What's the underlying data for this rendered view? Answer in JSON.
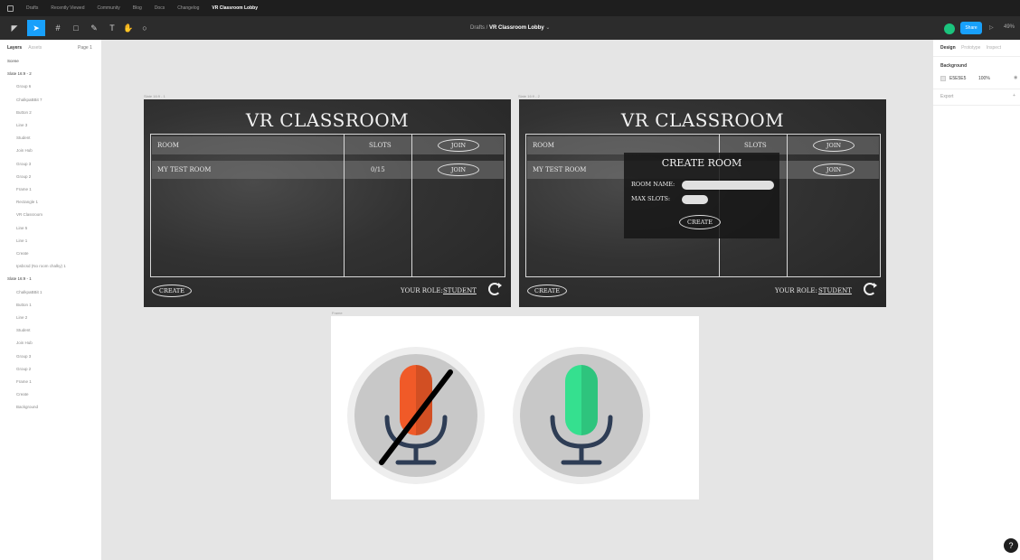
{
  "titlebar": {
    "tabs": [
      "Drafts",
      "Recently Viewed",
      "Community",
      "Blog",
      "Docs",
      "Changelog",
      "VR Classroom Lobby"
    ],
    "active_index": 6
  },
  "toolbar": {
    "breadcrumb_project": "Drafts /",
    "breadcrumb_file": "VR Classroom Lobby",
    "share_label": "Share",
    "zoom": "49%"
  },
  "left_panel": {
    "tabs": [
      "Layers",
      "Assets"
    ],
    "page": "Page 1",
    "layers": [
      {
        "label": "Scene",
        "top": true
      },
      {
        "label": "Slate 16:9 - 2",
        "top": true
      },
      {
        "label": "Group 6"
      },
      {
        "label": "ChalkpaBBit 7"
      },
      {
        "label": "Button 2"
      },
      {
        "label": "Line 3"
      },
      {
        "label": "Student"
      },
      {
        "label": "Join Hub"
      },
      {
        "label": "Group 3"
      },
      {
        "label": "Group 2"
      },
      {
        "label": "Frame 1"
      },
      {
        "label": "Rectangle 1"
      },
      {
        "label": "VR Classroom"
      },
      {
        "label": "Line 5"
      },
      {
        "label": "Line 1"
      },
      {
        "label": "Create"
      },
      {
        "label": "Ipsbcsd (No room chalky) 1"
      },
      {
        "label": "Slate 16:9 - 1",
        "top": true
      },
      {
        "label": "ChalkpaBBit 1"
      },
      {
        "label": "Button 1"
      },
      {
        "label": "Line 2"
      },
      {
        "label": "Student"
      },
      {
        "label": "Join Hub"
      },
      {
        "label": "Group 3"
      },
      {
        "label": "Group 2"
      },
      {
        "label": "Frame 1"
      },
      {
        "label": "Create"
      },
      {
        "label": "Background"
      }
    ]
  },
  "canvas": {
    "frame_labels": {
      "left": "Slate 16:9 - 1",
      "right": "Slate 16:9 - 2",
      "mic": "Frame"
    },
    "lobby": {
      "title": "VR CLASSROOM",
      "col_room": "ROOM",
      "col_slots": "SLOTS",
      "join": "JOIN",
      "room_name": "MY TEST ROOM",
      "room_slots": "0/15",
      "create": "CREATE",
      "role_label": "YOUR ROLE:",
      "role_value": "STUDENT"
    },
    "popup": {
      "title": "CREATE ROOM",
      "room_name_label": "ROOM NAME:",
      "max_slots_label": "MAX SLOTS:",
      "button": "CREATE"
    },
    "mic_icons": {
      "muted_color": "#f05a28",
      "active_color": "#35e08f",
      "circle_color": "#c8c8c8",
      "stand_color": "#2e3d55"
    }
  },
  "right_panel": {
    "tabs": [
      "Design",
      "Prototype",
      "Inspect"
    ],
    "background_label": "Background",
    "bg_hex": "E5E5E5",
    "bg_opacity": "100%",
    "export_label": "Export"
  },
  "help": "?"
}
